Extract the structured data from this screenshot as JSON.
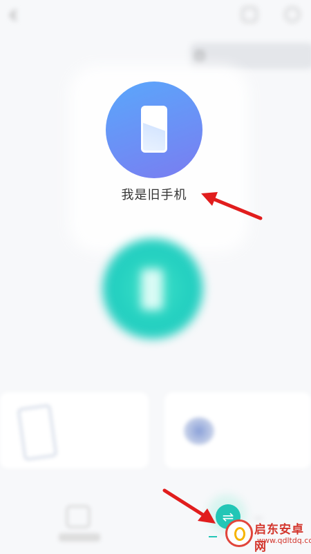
{
  "header": {
    "title": "",
    "back_icon": "back-arrow-icon",
    "right_icons": [
      "help-icon",
      "settings-icon"
    ],
    "record_button_label": ""
  },
  "old_device": {
    "label": "我是旧手机",
    "icon": "phone-icon",
    "gradient": [
      "#5aa7fb",
      "#7a7cf0"
    ]
  },
  "new_device": {
    "label": "",
    "icon": "phone-icon",
    "color": "#22cfc0"
  },
  "cards": [
    {
      "label": "",
      "icon": "iphone-transfer-icon"
    },
    {
      "label": "",
      "icon": "device-transfer-icon"
    }
  ],
  "bottom_nav": {
    "left_icon": "transfer-icon",
    "center_icon": "swap-arrows-icon",
    "accent": "#22c6b6"
  },
  "watermark": {
    "name": "启东安卓网",
    "url": "www.qdltdq.com"
  },
  "annotations": {
    "arrow_color": "#e11d1d"
  }
}
